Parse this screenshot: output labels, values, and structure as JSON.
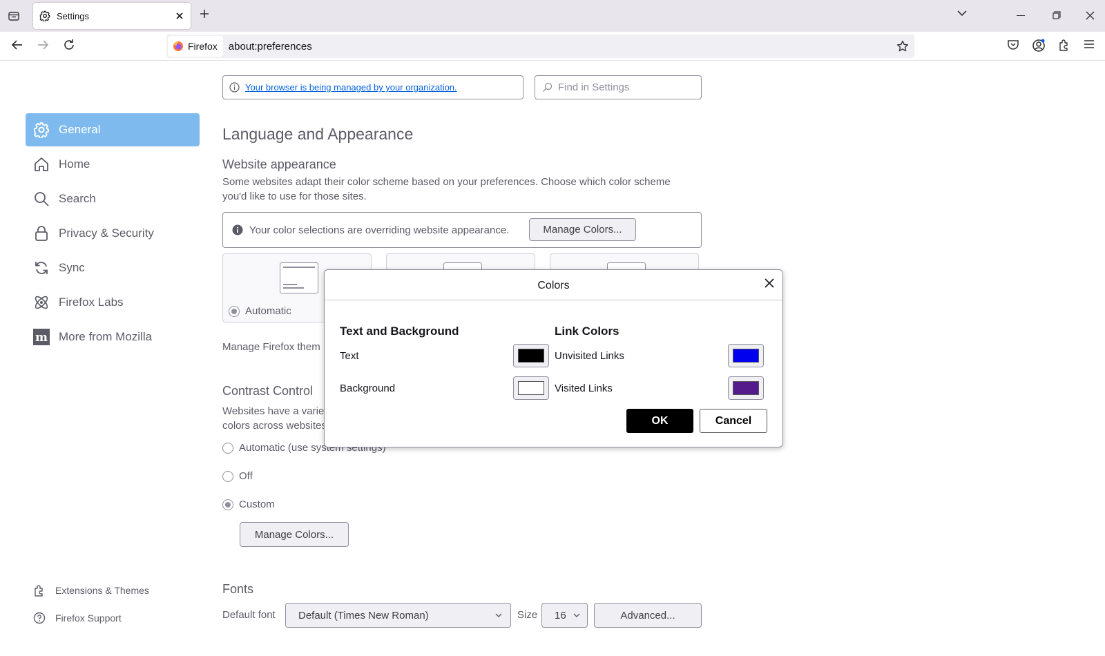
{
  "tabstrip": {
    "tab_title": "Settings"
  },
  "navbar": {
    "identity_label": "Firefox",
    "url": "about:preferences"
  },
  "banner": {
    "policy_text": "Your browser is being managed by your organization.",
    "search_placeholder": "Find in Settings"
  },
  "sidebar": {
    "items": [
      {
        "label": "General",
        "icon": "gear-icon"
      },
      {
        "label": "Home",
        "icon": "home-icon"
      },
      {
        "label": "Search",
        "icon": "search-icon"
      },
      {
        "label": "Privacy & Security",
        "icon": "lock-icon"
      },
      {
        "label": "Sync",
        "icon": "sync-icon"
      },
      {
        "label": "Firefox Labs",
        "icon": "labs-icon"
      },
      {
        "label": "More from Mozilla",
        "icon": "mozilla-icon"
      }
    ],
    "footer": [
      {
        "label": "Extensions & Themes",
        "icon": "puzzle-icon"
      },
      {
        "label": "Firefox Support",
        "icon": "help-icon"
      }
    ]
  },
  "main": {
    "section_title": "Language and Appearance",
    "website_appearance": {
      "heading": "Website appearance",
      "description_line1": "Some websites adapt their color scheme based on your preferences. Choose which color scheme",
      "description_line2": "you'd like to use for those sites.",
      "override_notice": "Your color selections are overriding website appearance.",
      "manage_colors_label": "Manage Colors...",
      "automatic_label": "Automatic",
      "manage_themes_text": "Manage Firefox them"
    },
    "contrast": {
      "heading": "Contrast Control",
      "description_line1": "Websites have a varie",
      "description_line2": "colors across websites",
      "options": [
        {
          "label": "Automatic (use system settings)",
          "checked": false
        },
        {
          "label": "Off",
          "checked": false
        },
        {
          "label": "Custom",
          "checked": true
        }
      ],
      "manage_colors_label": "Manage Colors..."
    },
    "fonts": {
      "heading": "Fonts",
      "default_font_label": "Default font",
      "default_font_value": "Default (Times New Roman)",
      "size_label": "Size",
      "size_value": "16",
      "advanced_label": "Advanced..."
    }
  },
  "dialog": {
    "title": "Colors",
    "text_bg_heading": "Text and Background",
    "link_heading": "Link Colors",
    "text_label": "Text",
    "background_label": "Background",
    "unvisited_label": "Unvisited Links",
    "visited_label": "Visited Links",
    "ok_label": "OK",
    "cancel_label": "Cancel",
    "colors": {
      "text": "#000000",
      "background": "#ffffff",
      "unvisited": "#0000ee",
      "visited": "#551a8b"
    }
  },
  "colors": {
    "accent": "#7ebaee",
    "link": "#0061e0"
  }
}
